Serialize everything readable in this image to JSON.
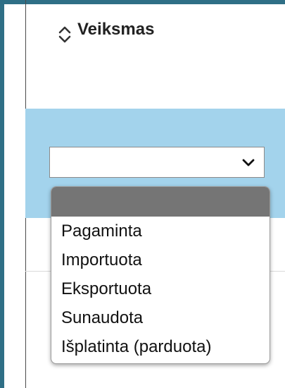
{
  "column": {
    "title": "Veiksmas",
    "sort_icon": "sort-up-down-icon"
  },
  "filter": {
    "selected_value": "",
    "chevron_icon": "chevron-down-icon",
    "options": [
      "",
      "Pagaminta",
      "Importuota",
      "Eksportuota",
      "Sunaudota",
      "Išplatinta (parduota)"
    ]
  },
  "colors": {
    "frame_border": "#2f6f86",
    "filter_band": "#a3d3ec",
    "highlighted_option": "#757575"
  }
}
